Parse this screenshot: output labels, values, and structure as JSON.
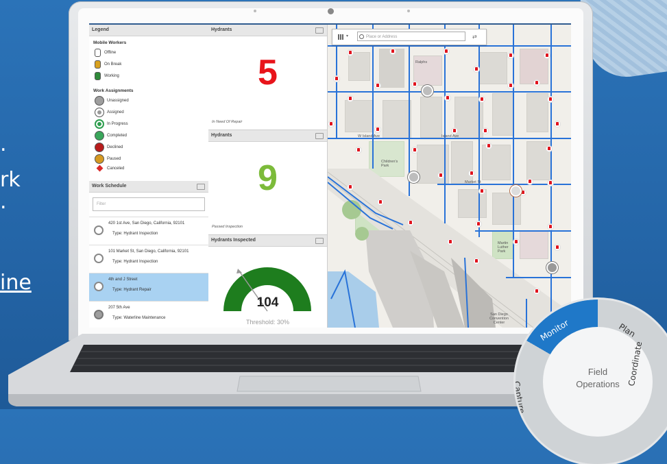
{
  "background": {
    "text_lines": [
      ".",
      "rk",
      ".",
      "ine"
    ],
    "brand_color": "#2465a7"
  },
  "legend": {
    "title": "Legend",
    "mobile_workers_heading": "Mobile Workers",
    "workers": [
      {
        "label": "Offline",
        "color": "#ffffff"
      },
      {
        "label": "On Break",
        "color": "#d9a21f"
      },
      {
        "label": "Working",
        "color": "#2f8a3a"
      }
    ],
    "work_assignments_heading": "Work Assignments",
    "assignments": [
      {
        "label": "Unassigned",
        "color": "#9e9e9e"
      },
      {
        "label": "Assigned",
        "color": "#ffffff"
      },
      {
        "label": "In Progress",
        "color": "#2f9e4f"
      },
      {
        "label": "Completed",
        "color": "#3aa65b"
      },
      {
        "label": "Declined",
        "color": "#b81c1c"
      },
      {
        "label": "Paused",
        "color": "#d69a22"
      },
      {
        "label": "Canceled",
        "color": "#d92a2a"
      }
    ]
  },
  "schedule": {
    "title": "Work Schedule",
    "filter_placeholder": "Filter",
    "items": [
      {
        "address": "420 1st Ave, San Diego, California, 92101",
        "type": "Type: Hydrant Inspection"
      },
      {
        "address": "101 Market St, San Diego, California, 92101",
        "type": "Type: Hydrant Inspection"
      },
      {
        "address": "4th and J Street",
        "type": "Type: Hydrant Repair"
      },
      {
        "address": "207 5th Ave",
        "type": "Type: Waterline Maintenance"
      }
    ],
    "selected_index": 2
  },
  "indicators": [
    {
      "title": "Hydrants",
      "value": "5",
      "caption": "In Need Of Repair",
      "color": "#e8141b"
    },
    {
      "title": "Hydrants",
      "value": "9",
      "caption": "Passed Inspection",
      "color": "#7cbb3a"
    }
  ],
  "gauge": {
    "title": "Hydrants Inspected",
    "value": "104",
    "threshold_label": "Threshold: 30%",
    "color": "#1e7d1e"
  },
  "map": {
    "search_placeholder": "Place or Address",
    "labels": [
      "Ralphs",
      "W Island Ave",
      "Island Ave",
      "Children's Park",
      "Market St",
      "Martin Luther Park",
      "San Diego Convention Center"
    ]
  },
  "wheel": {
    "center_line1": "Field",
    "center_line2": "Operations",
    "segments": [
      "Monitor",
      "Plan",
      "Coordinate",
      "Capture"
    ],
    "active": "Monitor",
    "active_color": "#1f78c8"
  }
}
